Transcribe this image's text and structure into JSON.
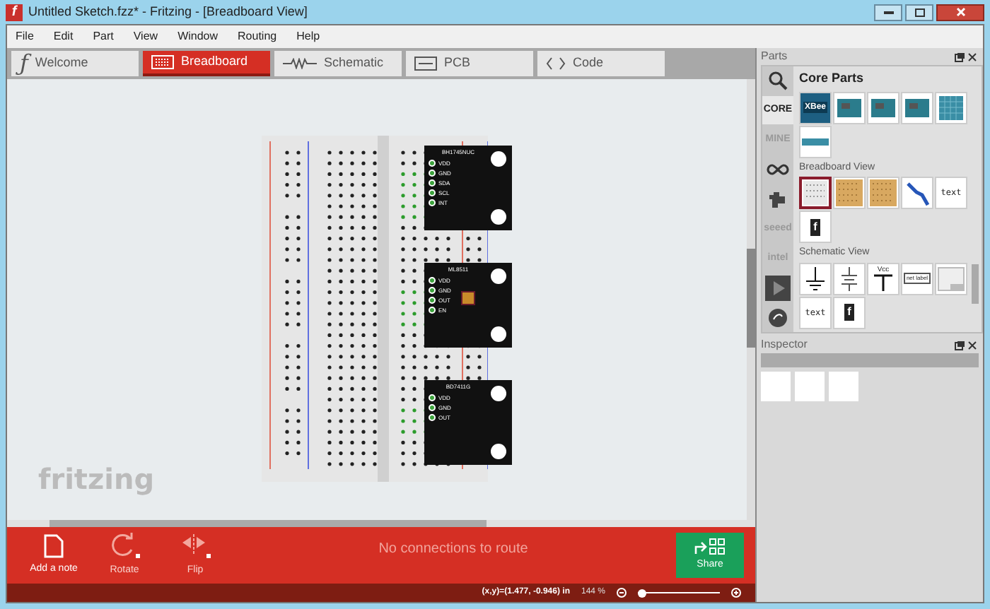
{
  "window": {
    "title": "Untitled Sketch.fzz* - Fritzing - [Breadboard View]",
    "icon": "f"
  },
  "menu": [
    "File",
    "Edit",
    "Part",
    "View",
    "Window",
    "Routing",
    "Help"
  ],
  "tabs": [
    {
      "label": "Welcome",
      "kind": "welcome",
      "icon": "ƒ",
      "selected": false
    },
    {
      "label": "Breadboard",
      "kind": "breadboard",
      "selected": true
    },
    {
      "label": "Schematic",
      "kind": "schematic",
      "selected": false
    },
    {
      "label": "PCB",
      "kind": "pcb",
      "selected": false
    },
    {
      "label": "Code",
      "kind": "code",
      "selected": false
    }
  ],
  "canvas": {
    "logo": "fritzing",
    "modules": [
      {
        "title": "BH1745NUC",
        "pins": [
          "VDD",
          "GND",
          "SDA",
          "SCL",
          "INT"
        ]
      },
      {
        "title": "ML8511",
        "pins": [
          "VDD",
          "GND",
          "OUT",
          "EN"
        ]
      },
      {
        "title": "BD7411G",
        "pins": [
          "VDD",
          "GND",
          "OUT"
        ]
      }
    ]
  },
  "toolbar": {
    "tools": [
      {
        "label": "Add a note",
        "kind": "note"
      },
      {
        "label": "Rotate",
        "kind": "rotate"
      },
      {
        "label": "Flip",
        "kind": "flip"
      }
    ],
    "message": "No connections to route",
    "share": "Share"
  },
  "status_bar": {
    "coordinates": "(x,y)=(1.477, -0.946) in",
    "zoom": "144 %",
    "zoom_slider": {
      "level": 0.05
    }
  },
  "parts": {
    "title": "Parts",
    "bin": "Core Parts",
    "bins": [
      {
        "kind": "search",
        "selected": false
      },
      {
        "kind": "core",
        "label": "CORE",
        "selected": true
      },
      {
        "kind": "mine",
        "label": "MINE",
        "selected": false
      },
      {
        "kind": "arduino",
        "selected": false
      },
      {
        "kind": "snap",
        "selected": false
      },
      {
        "kind": "seeed",
        "label": "seeed",
        "selected": false
      },
      {
        "kind": "intel",
        "label": "intel",
        "selected": false
      },
      {
        "kind": "play",
        "selected": false
      },
      {
        "kind": "contrib",
        "selected": false
      }
    ],
    "sections": [
      {
        "tiles": [
          {
            "kind": "xbee",
            "label": "XBee"
          },
          {
            "kind": "board"
          },
          {
            "kind": "board"
          },
          {
            "kind": "board"
          },
          {
            "kind": "grid"
          },
          {
            "kind": "strip"
          }
        ]
      },
      {
        "heading": "Breadboard View",
        "tiles": [
          {
            "kind": "breadboard"
          },
          {
            "kind": "perf"
          },
          {
            "kind": "perf"
          },
          {
            "kind": "wire"
          },
          {
            "kind": "text",
            "label": "text"
          },
          {
            "kind": "logo",
            "label": "f"
          }
        ]
      },
      {
        "heading": "Schematic View",
        "tiles": [
          {
            "kind": "ground"
          },
          {
            "kind": "power"
          },
          {
            "kind": "vcc",
            "label": "Vcc"
          },
          {
            "kind": "netlabel",
            "label": "net label"
          },
          {
            "kind": "frame"
          },
          {
            "kind": "text",
            "label": "text"
          },
          {
            "kind": "logo",
            "label": "f"
          }
        ]
      }
    ]
  },
  "inspector": {
    "title": "Inspector"
  }
}
